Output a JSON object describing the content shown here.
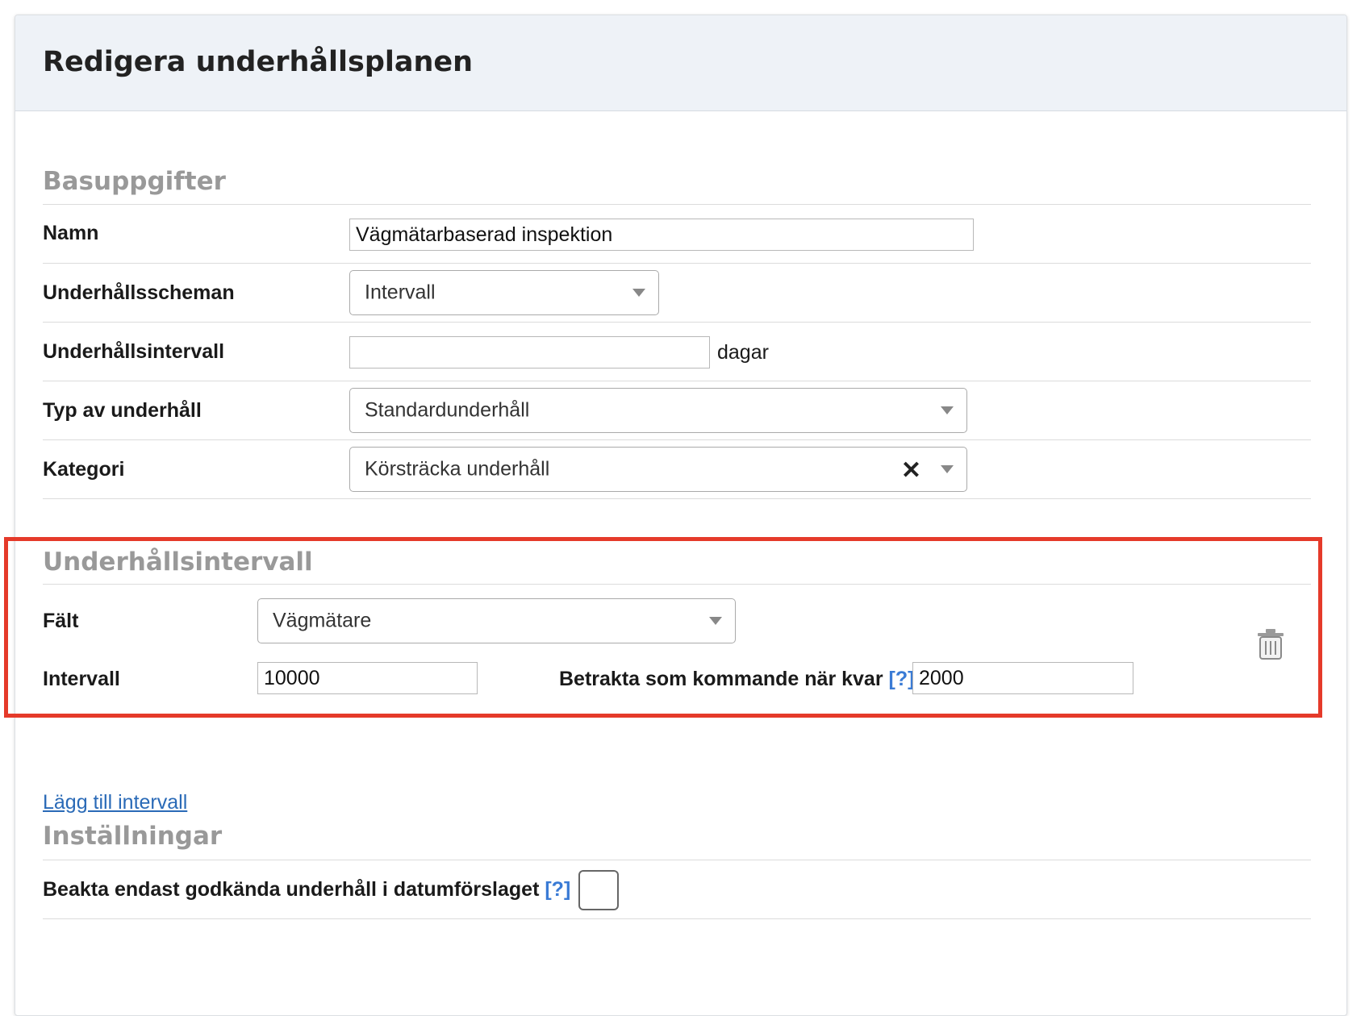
{
  "header": {
    "title": "Redigera underhållsplanen"
  },
  "basic": {
    "section_title": "Basuppgifter",
    "name_label": "Namn",
    "name_value": "Vägmätarbaserad inspektion",
    "schedule_label": "Underhållsscheman",
    "schedule_value": "Intervall",
    "interval_label": "Underhållsintervall",
    "interval_value": "",
    "interval_suffix": "dagar",
    "type_label": "Typ av underhåll",
    "type_value": "Standardunderhåll",
    "category_label": "Kategori",
    "category_value": "Körsträcka underhåll",
    "clear_glyph": "✕"
  },
  "interval": {
    "section_title": "Underhållsintervall",
    "field_label": "Fält",
    "field_value": "Vägmätare",
    "interval_label": "Intervall",
    "interval_value": "10000",
    "upcoming_label": "Betrakta som kommande när kvar",
    "upcoming_help": "[?]",
    "upcoming_value": "2000",
    "delete_icon": "trash-icon"
  },
  "actions": {
    "add_interval": "Lägg till intervall"
  },
  "settings": {
    "section_title": "Inställningar",
    "approved_label": "Beakta endast godkända underhåll i datumförslaget",
    "approved_help": "[?]",
    "approved_checked": false
  },
  "colors": {
    "highlight": "#e53a2a",
    "link": "#2a6ab7",
    "help": "#3a7bd5"
  }
}
